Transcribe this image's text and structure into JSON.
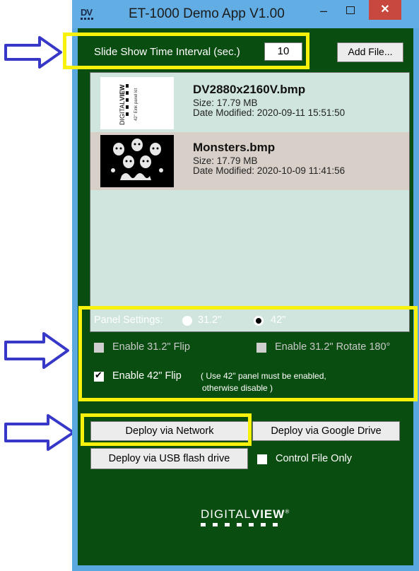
{
  "window": {
    "title": "ET-1000 Demo App V1.00",
    "app_icon_text": "DV",
    "min_glyph": "–",
    "close_glyph": "✕"
  },
  "toolbar": {
    "interval_label": "Slide Show Time Interval (sec.)",
    "interval_value": "10",
    "add_file_label": "Add File..."
  },
  "files": [
    {
      "name": "DV2880x2160V.bmp",
      "size": "Size: 17.79 MB",
      "modified": "Date Modified: 2020-09-11 15:51:50",
      "thumb_text": "DIGITALVIEW  42\" Eink panel kit",
      "selected": false
    },
    {
      "name": "Monsters.bmp",
      "size": "Size: 17.79 MB",
      "modified": "Date Modified: 2020-10-09 11:41:56",
      "selected": true
    }
  ],
  "panel": {
    "label": "Panel Settings:",
    "option_31": "31.2\"",
    "option_42": "42\"",
    "selected": "42\"",
    "flip31_label": "Enable 31.2\" Flip",
    "flip31_checked": false,
    "rotate31_label": "Enable 31.2\" Rotate 180°",
    "rotate31_checked": false,
    "flip42_label": "Enable 42\" Flip",
    "flip42_checked": true,
    "flip42_note_line1": "( Use 42\" panel must be enabled,",
    "flip42_note_line2": "otherwise disable )"
  },
  "deploy": {
    "network": "Deploy via Network",
    "google_drive": "Deploy via Google Drive",
    "usb": "Deploy via USB flash drive",
    "control_file_only": "Control File Only",
    "control_file_only_checked": false
  },
  "logo": {
    "text_light": "DIGITAL",
    "text_bold": "VIEW",
    "mark": "®"
  },
  "colors": {
    "window_frame": "#5aa8e0",
    "client_bg": "#0a4d10",
    "list_bg": "#cfe5dd",
    "selected_row": "#d8d0c8",
    "highlight": "#f7f10b",
    "arrow": "#3838c8",
    "close_button": "#c8473e"
  }
}
